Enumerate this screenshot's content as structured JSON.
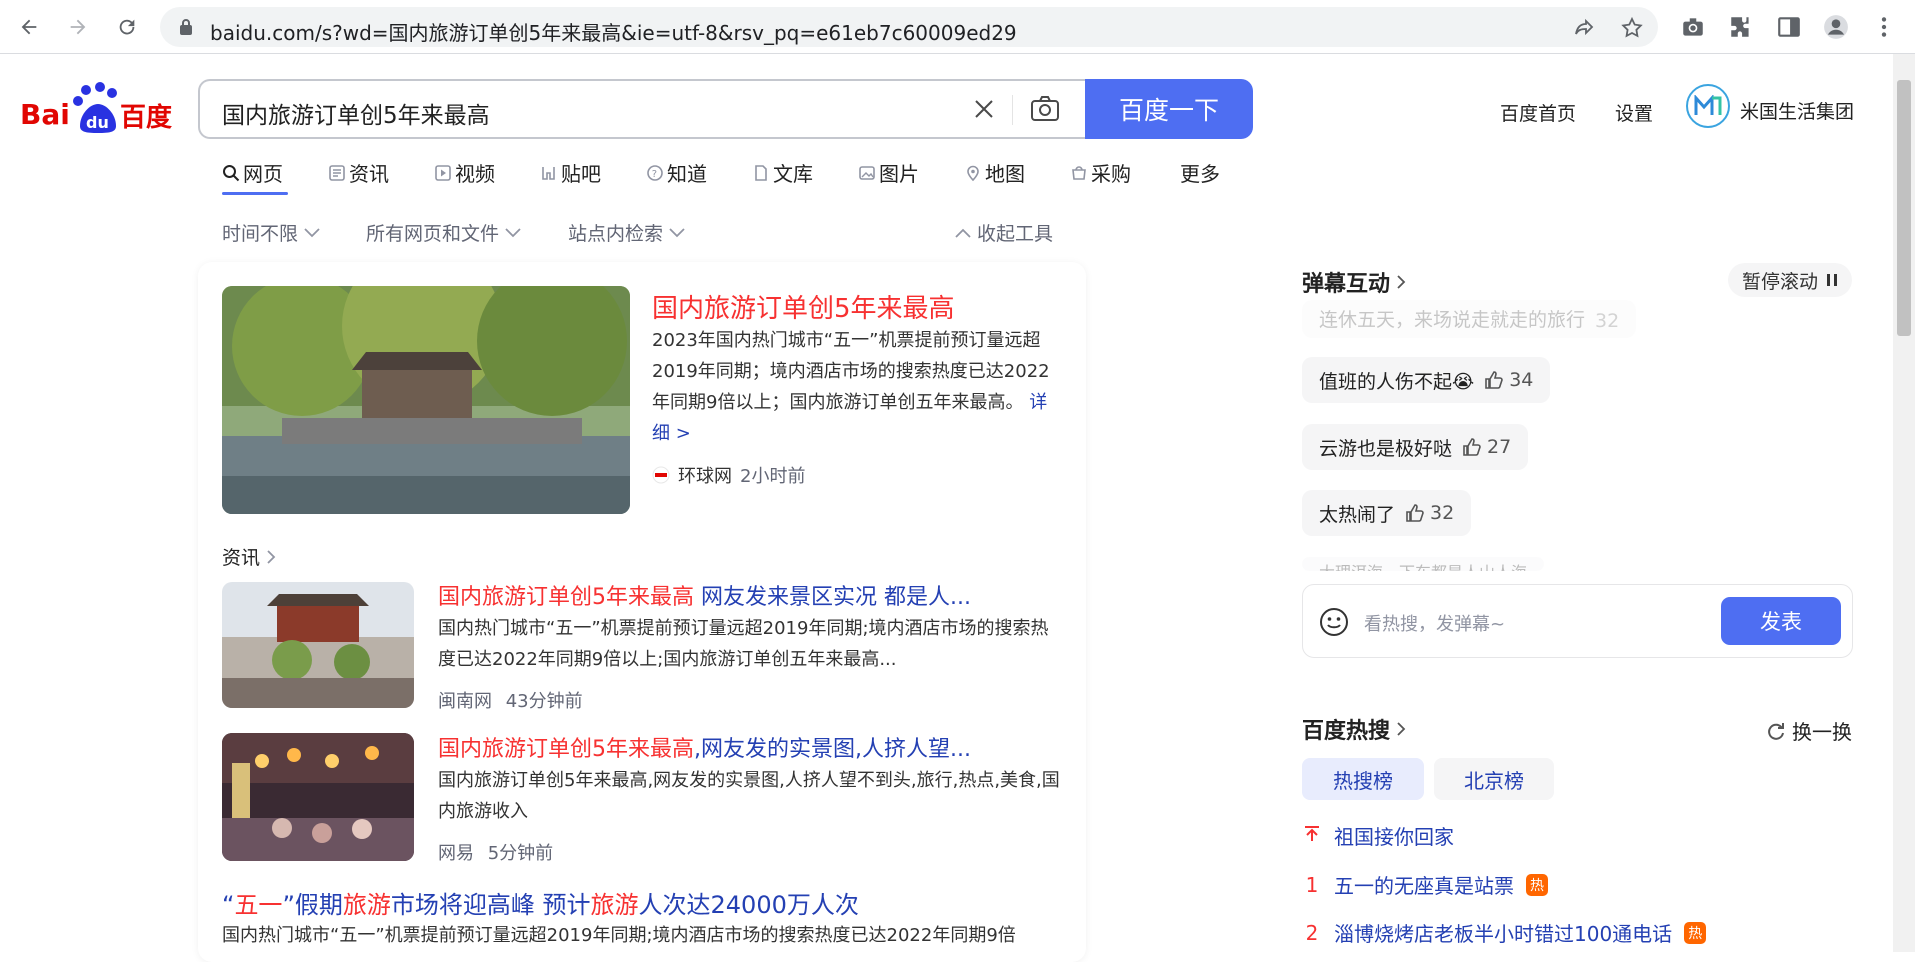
{
  "browser": {
    "url": "baidu.com/s?wd=国内旅游订单创5年来最高&ie=utf-8&rsv_pq=e61eb7c60009ed29"
  },
  "header": {
    "logo_text": "Bai百度",
    "search_query": "国内旅游订单创5年来最高",
    "search_button": "百度一下",
    "links": [
      "百度首页",
      "设置"
    ],
    "user_name": "米国生活集团"
  },
  "tabs": [
    {
      "label": "网页",
      "icon": "search-icon"
    },
    {
      "label": "资讯",
      "icon": "news-icon"
    },
    {
      "label": "视频",
      "icon": "video-icon"
    },
    {
      "label": "贴吧",
      "icon": "tieba-icon"
    },
    {
      "label": "知道",
      "icon": "question-icon"
    },
    {
      "label": "文库",
      "icon": "document-icon"
    },
    {
      "label": "图片",
      "icon": "image-icon"
    },
    {
      "label": "地图",
      "icon": "map-icon"
    },
    {
      "label": "采购",
      "icon": "cart-icon"
    },
    {
      "label": "更多",
      "icon": ""
    }
  ],
  "filters": {
    "time": "时间不限",
    "scope": "所有网页和文件",
    "site": "站点内检索",
    "collapse": "收起工具"
  },
  "results": {
    "top": {
      "title": "国内旅游订单创5年来最高",
      "desc": "2023年国内热门城市“五一”机票提前预订量远超2019年同期；境内酒店市场的搜索热度已达2022年同期9倍以上；国内旅游订单创五年来最高。",
      "more": "详细 >",
      "source": "环球网",
      "time": "2小时前"
    },
    "news_label": "资讯",
    "news": [
      {
        "title_red": "国内旅游订单创5年来最高",
        "title_rest": " 网友发来景区实况 都是人...",
        "desc": "国内热门城市“五一”机票提前预订量远超2019年同期;境内酒店市场的搜索热度已达2022年同期9倍以上;国内旅游订单创五年来最高...",
        "source": "闽南网",
        "time": "43分钟前"
      },
      {
        "title_red": "国内旅游订单创5年来最高",
        "title_rest": ",网友发的实景图,人挤人望...",
        "desc": "国内旅游订单创5年来最高,网友发的实景图,人挤人望不到头,旅行,热点,美食,国内旅游收入",
        "source": "网易",
        "time": "5分钟前"
      }
    ],
    "bottom": {
      "p1": "“",
      "p2": "五一",
      "p3": "”假期",
      "p4": "旅游",
      "p5": "市场将迎高峰 预计",
      "p6": "旅游",
      "p7": "人次达24000万人次",
      "desc": "国内热门城市“五一”机票提前预订量远超2019年同期;境内酒店市场的搜索热度已达2022年同期9倍"
    }
  },
  "danmu": {
    "title": "弹幕互动",
    "pause": "暂停滚动",
    "faded_top": "连休五天，来场说走就走的旅行",
    "faded_top_likes": "32",
    "items": [
      {
        "text": "值班的人伤不起😭",
        "likes": "34"
      },
      {
        "text": "云游也是极好哒",
        "likes": "27"
      },
      {
        "text": "太热闹了",
        "likes": "32"
      }
    ],
    "faded_bottom": "大理洱海一下车都是人山人海",
    "input_placeholder": "看热搜，发弹幕~",
    "send": "发表"
  },
  "hot": {
    "title": "百度热搜",
    "refresh": "换一换",
    "tabs": [
      "热搜榜",
      "北京榜"
    ],
    "items": [
      {
        "rank": "",
        "text": "祖国接你回家",
        "badge": ""
      },
      {
        "rank": "1",
        "text": "五一的无座真是站票",
        "badge": "热"
      },
      {
        "rank": "2",
        "text": "淄博烧烤店老板半小时错过100通电话",
        "badge": "热"
      }
    ]
  },
  "colors": {
    "brand_blue": "#4e6ef2",
    "link_blue": "#2440b3",
    "highlight_red": "#f73131",
    "hot_orange": "#ff6600"
  }
}
